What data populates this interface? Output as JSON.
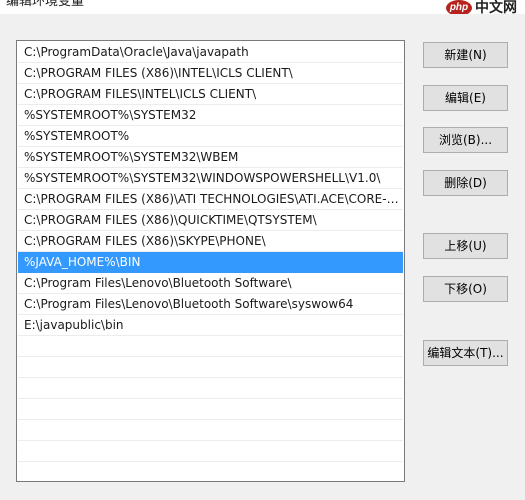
{
  "window": {
    "title": "编辑环境变量"
  },
  "watermark": {
    "logo": "php",
    "text": "中文网"
  },
  "path_list": {
    "items": [
      "C:\\ProgramData\\Oracle\\Java\\javapath",
      "C:\\PROGRAM FILES (X86)\\INTEL\\ICLS CLIENT\\",
      "C:\\PROGRAM FILES\\INTEL\\ICLS CLIENT\\",
      "%SYSTEMROOT%\\SYSTEM32",
      "%SYSTEMROOT%",
      "%SYSTEMROOT%\\SYSTEM32\\WBEM",
      "%SYSTEMROOT%\\SYSTEM32\\WINDOWSPOWERSHELL\\V1.0\\",
      "C:\\PROGRAM FILES (X86)\\ATI TECHNOLOGIES\\ATI.ACE\\CORE-S...",
      "C:\\PROGRAM FILES (X86)\\QUICKTIME\\QTSYSTEM\\",
      "C:\\PROGRAM FILES (X86)\\SKYPE\\PHONE\\",
      "%JAVA_HOME%\\BIN",
      "C:\\Program Files\\Lenovo\\Bluetooth Software\\",
      "C:\\Program Files\\Lenovo\\Bluetooth Software\\syswow64",
      "E:\\javapublic\\bin",
      "",
      "",
      "",
      "",
      "",
      "",
      ""
    ],
    "selected_index": 10
  },
  "buttons": {
    "new": "新建(N)",
    "edit": "编辑(E)",
    "browse": "浏览(B)...",
    "delete": "删除(D)",
    "move_up": "上移(U)",
    "move_down": "下移(O)",
    "edit_text": "编辑文本(T)..."
  },
  "colors": {
    "selection": "#3399ff",
    "dialog_background": "#f0f0f0",
    "watermark_logo": "#b7241f"
  }
}
